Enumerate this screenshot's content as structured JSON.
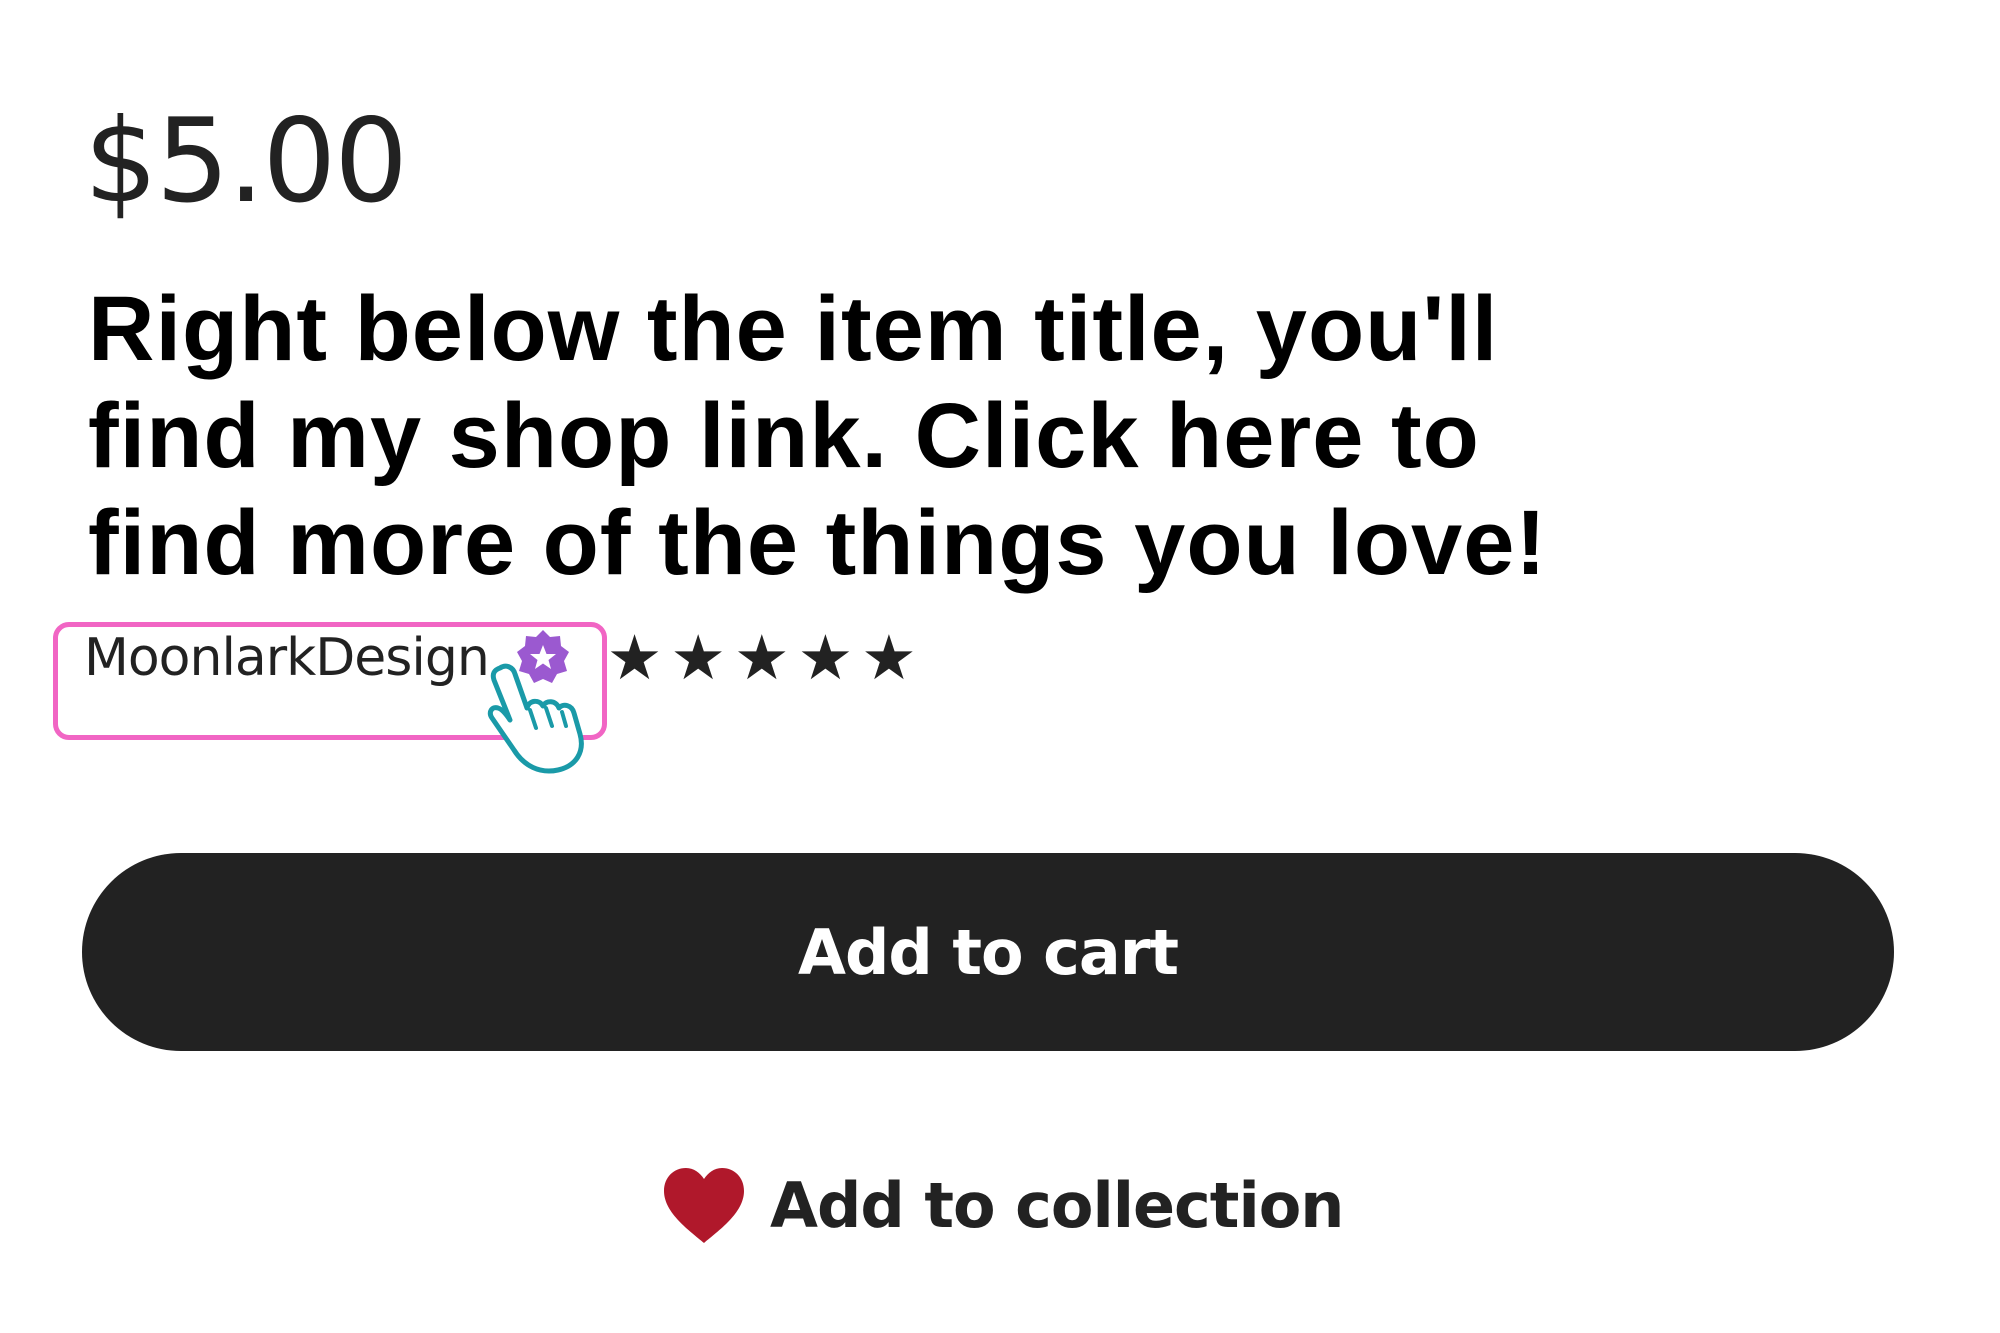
{
  "listing": {
    "price": "$5.00",
    "headline_lines": [
      "Right below the item title, you'll",
      "find my shop link. Click here to",
      "find more of the things you love!"
    ],
    "shop_name": "MoonlarkDesign",
    "badge_icon": "star-seller-badge-icon",
    "rating_stars": 5,
    "star_glyph": "★",
    "add_to_cart_label": "Add to cart",
    "add_to_collection_label": "Add to collection"
  },
  "colors": {
    "text": "#222222",
    "button_bg": "#222222",
    "button_text": "#ffffff",
    "badge": "#9b59d0",
    "heart": "#b0182b",
    "highlight": "#f165c4",
    "cursor": "#1a9aa8"
  }
}
